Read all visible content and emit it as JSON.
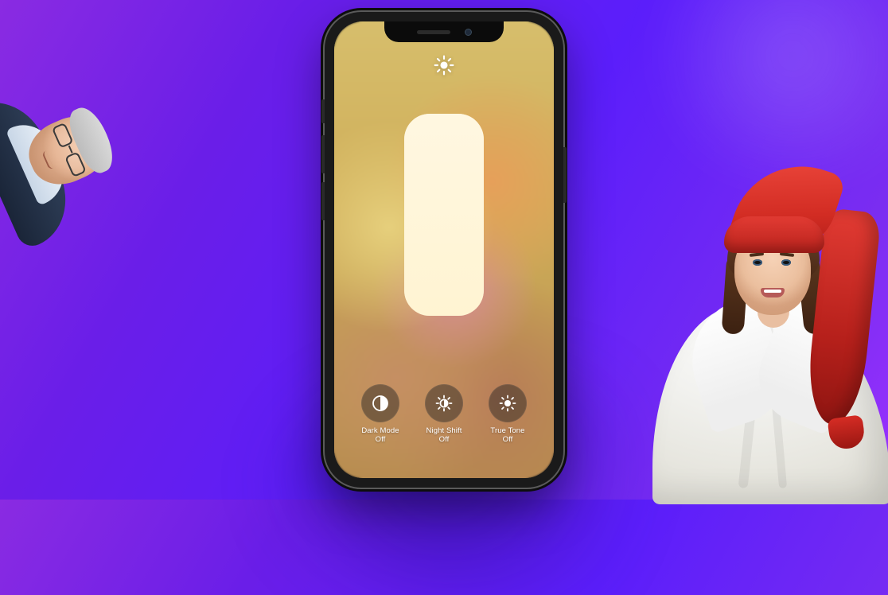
{
  "header": {
    "icon_name": "sun-icon"
  },
  "brightness": {
    "percent": 100
  },
  "controls": [
    {
      "id": "dark-mode",
      "name": "Dark Mode",
      "state": "Off",
      "icon": "dark-mode-icon"
    },
    {
      "id": "night-shift",
      "name": "Night Shift",
      "state": "Off",
      "icon": "night-shift-icon"
    },
    {
      "id": "true-tone",
      "name": "True Tone",
      "state": "Off",
      "icon": "true-tone-icon"
    }
  ],
  "decorations": {
    "left_person": "man-with-glasses",
    "right_person": "woman-red-nightcap-bathrobe"
  },
  "colors": {
    "bg_gradient_start": "#8a2be2",
    "bg_gradient_end": "#5b1efb",
    "cap_red": "#d22c23",
    "robe_white": "#f5f4ee"
  }
}
